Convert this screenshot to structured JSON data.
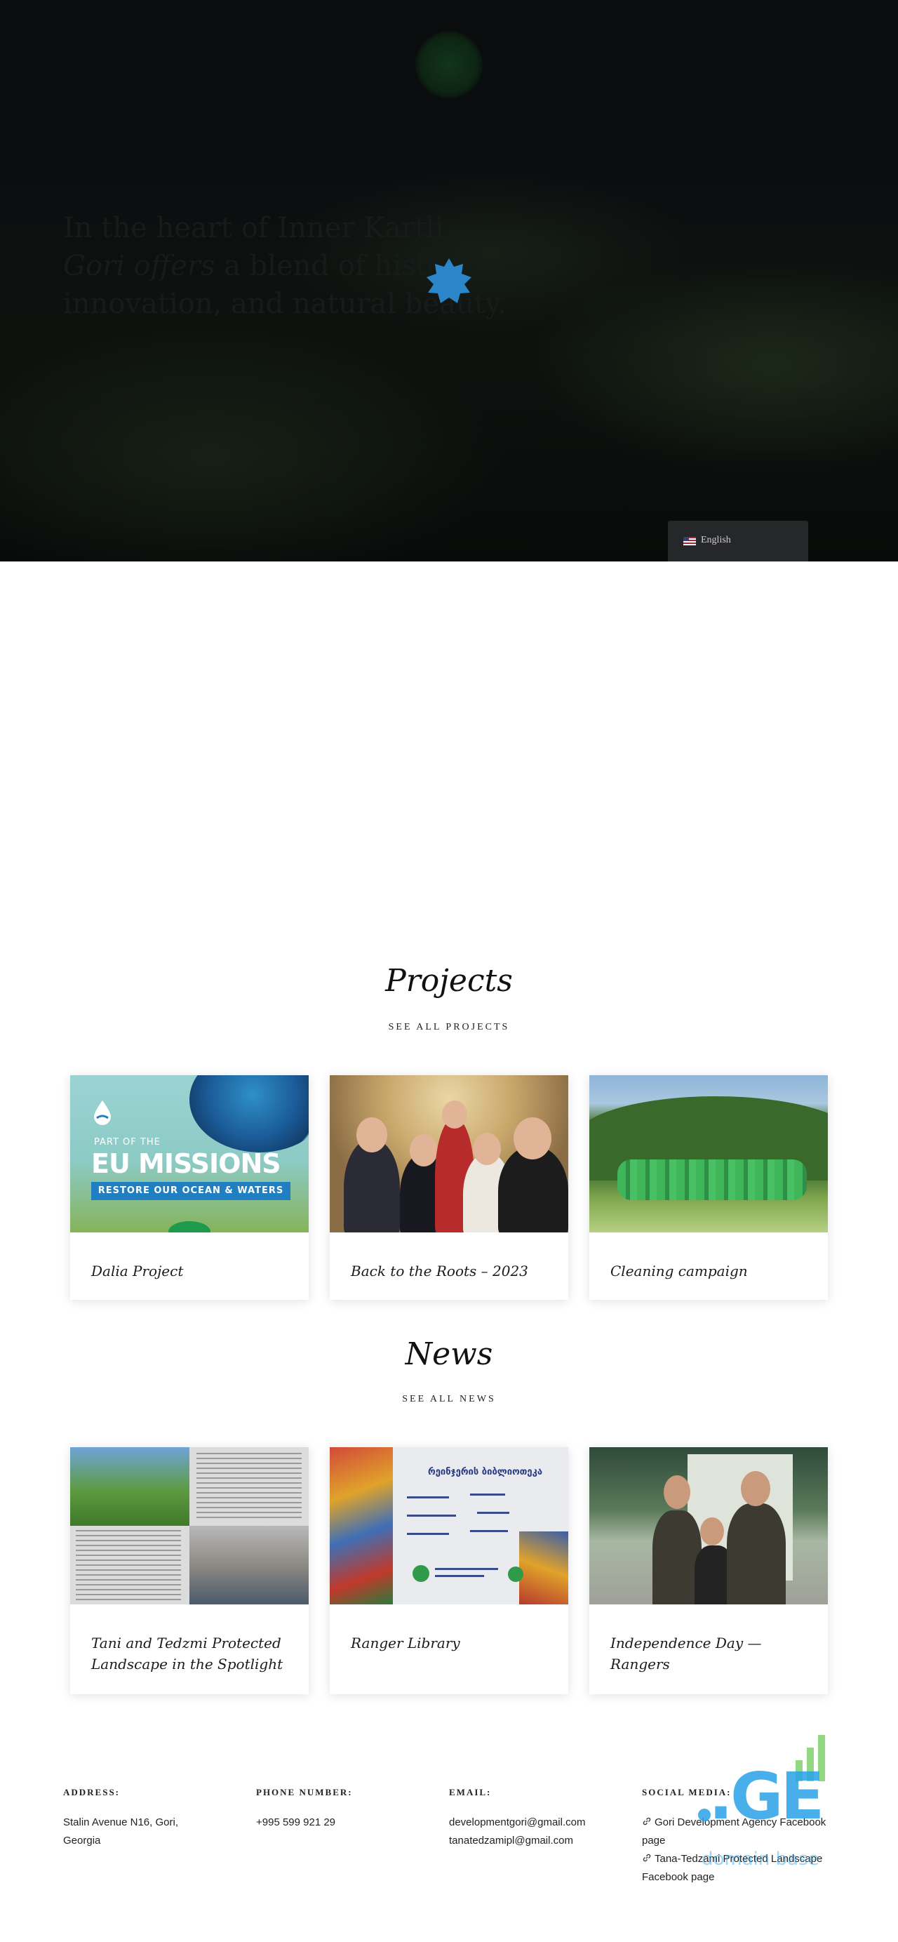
{
  "hero": {
    "headline_line1": "In the heart of Inner Kartli,",
    "headline_em": "Gori offers",
    "headline_rest": " a blend of history, innovation, and natural beauty.",
    "language": "English"
  },
  "projects": {
    "title": "Projects",
    "see_all": "SEE ALL PROJECTS",
    "items": [
      {
        "title": "Dalia Project",
        "thumb": {
          "part_of": "PART OF THE",
          "headline": "EU MISSIONS",
          "band": "RESTORE OUR OCEAN & WATERS"
        }
      },
      {
        "title": "Back to the Roots – 2023"
      },
      {
        "title": "Cleaning campaign"
      }
    ]
  },
  "news": {
    "title": "News",
    "see_all": "SEE ALL NEWS",
    "items": [
      {
        "title": "Tani and Tedzmi Protected Landscape in the Spotlight"
      },
      {
        "title": "Ranger Library",
        "thumb": {
          "heading": "რეინჯერის ბიბლიოთეკა"
        }
      },
      {
        "title": "Independence Day — Rangers"
      }
    ]
  },
  "footer": {
    "address_label": "ADDRESS:",
    "address": "Stalin Avenue N16, Gori, Georgia",
    "phone_label": "PHONE NUMBER:",
    "phone": "+995 599 921 29",
    "email_label": "EMAIL:",
    "emails": [
      "developmentgori@gmail.com",
      "tanatedzamipl@gmail.com"
    ],
    "social_label": "SOCIAL MEDIA:",
    "social_links": [
      "Gori Development Agency Facebook page",
      "Tana-Tedzami Protected Landscape Facebook page"
    ]
  },
  "watermark": {
    "logo_text": ".GE",
    "sub_text": "domain base"
  },
  "colors": {
    "accent_blue": "#1f7fc0",
    "spinner_blue": "#2a86c8",
    "hero_bg": "#0a0c0d",
    "lang_bg": "#262729"
  },
  "icons": [
    "logo-emblem",
    "loading-spinner-icon",
    "us-flag-icon",
    "link-icon"
  ]
}
